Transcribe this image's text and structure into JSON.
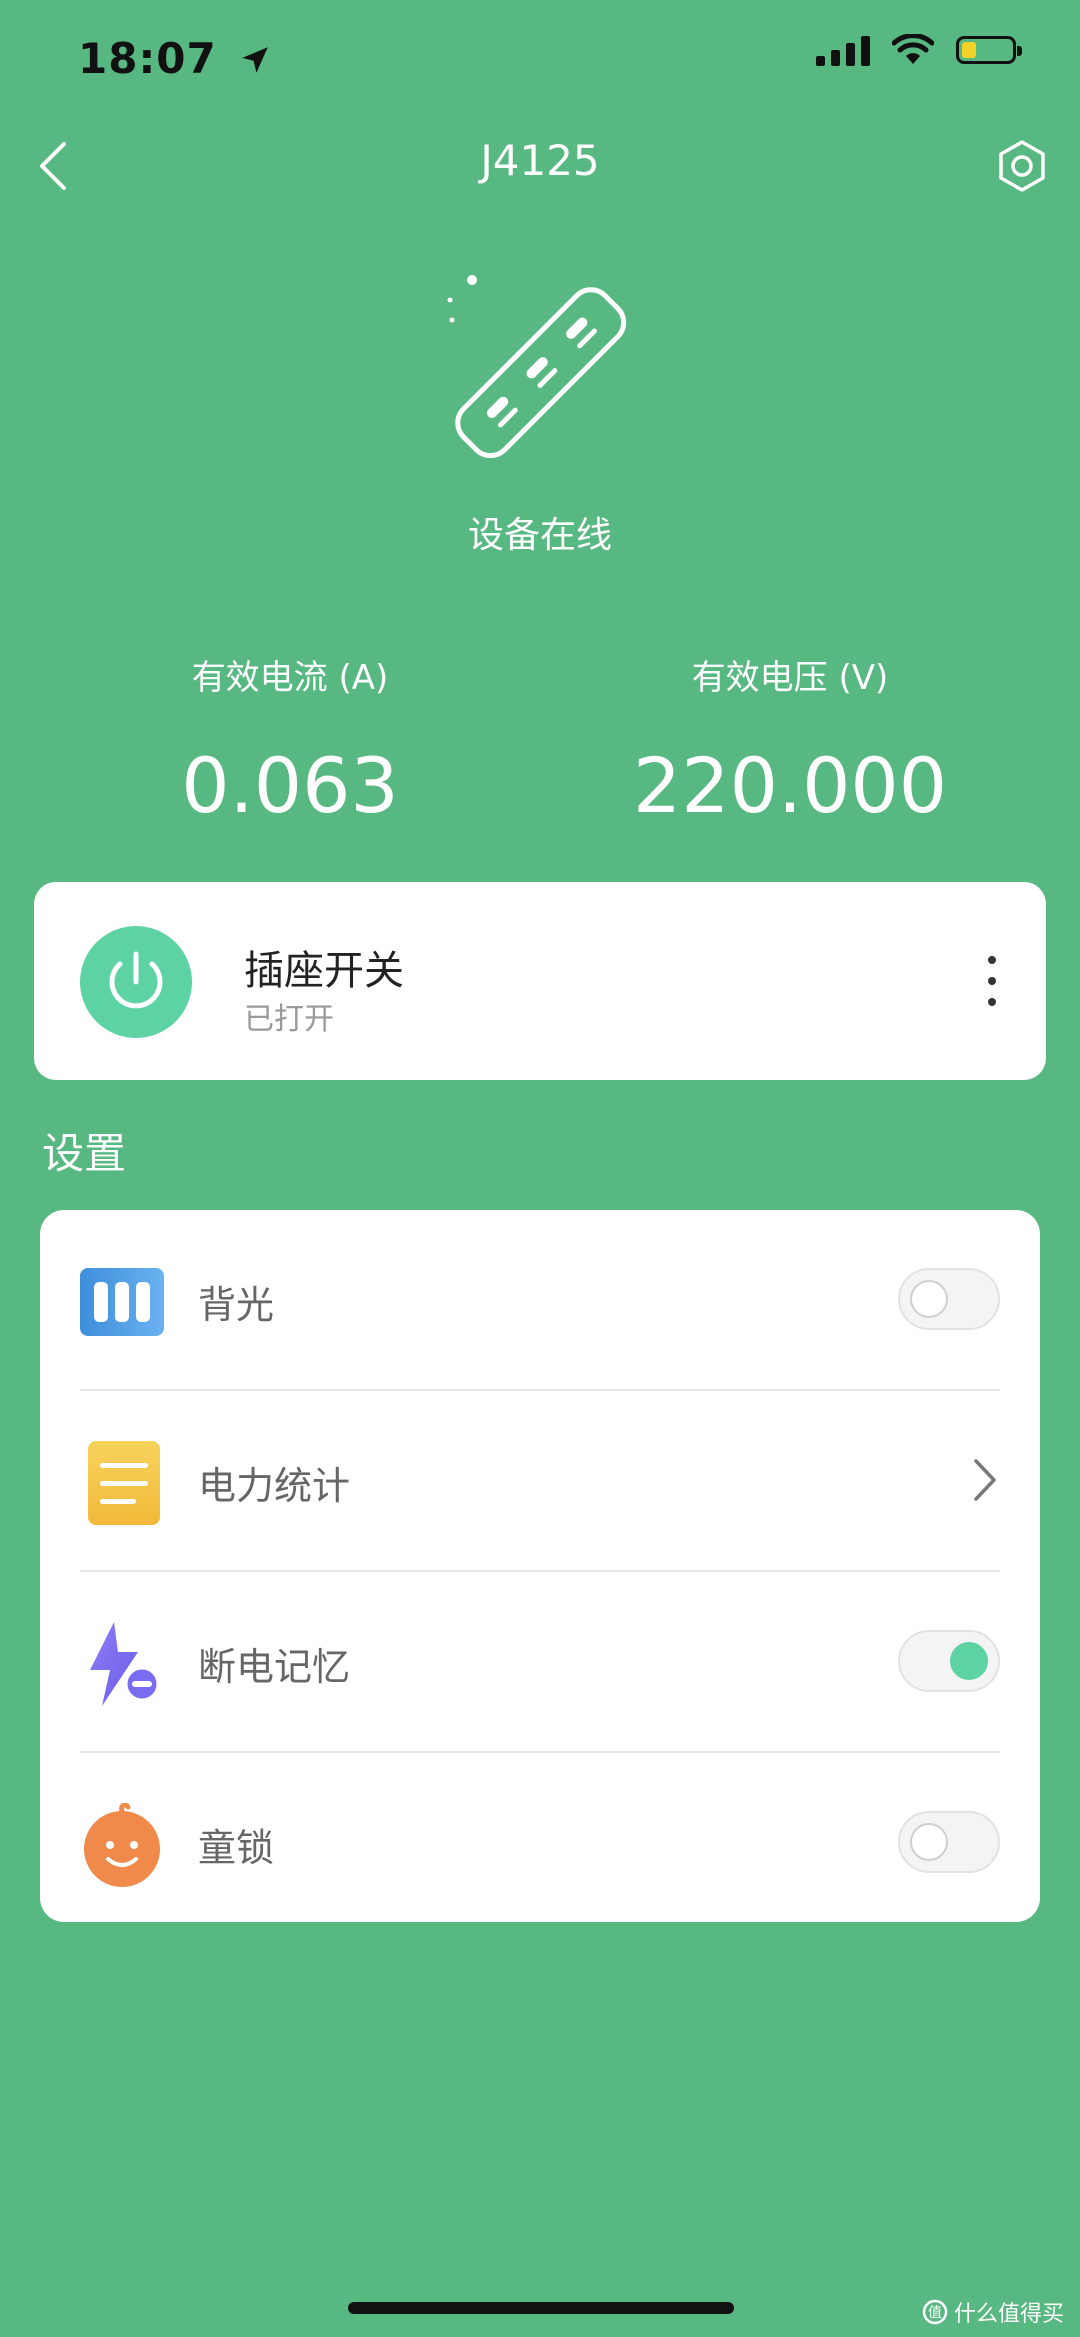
{
  "status_bar": {
    "time": "18:07"
  },
  "header": {
    "title": "J4125"
  },
  "device": {
    "status": "设备在线"
  },
  "readings": [
    {
      "label": "有效电流 (A)",
      "value": "0.063"
    },
    {
      "label": "有效电压 (V)",
      "value": "220.000"
    }
  ],
  "switch_card": {
    "title": "插座开关",
    "state": "已打开"
  },
  "settings": {
    "title": "设置",
    "items": [
      {
        "label": "背光",
        "control": "toggle",
        "on": false
      },
      {
        "label": "电力统计",
        "control": "chevron"
      },
      {
        "label": "断电记忆",
        "control": "toggle",
        "on": true
      },
      {
        "label": "童锁",
        "control": "toggle",
        "on": false
      }
    ]
  },
  "colors": {
    "background": "#58B882",
    "accent": "#5DD2A3"
  },
  "watermark": {
    "text": "什么值得买"
  }
}
